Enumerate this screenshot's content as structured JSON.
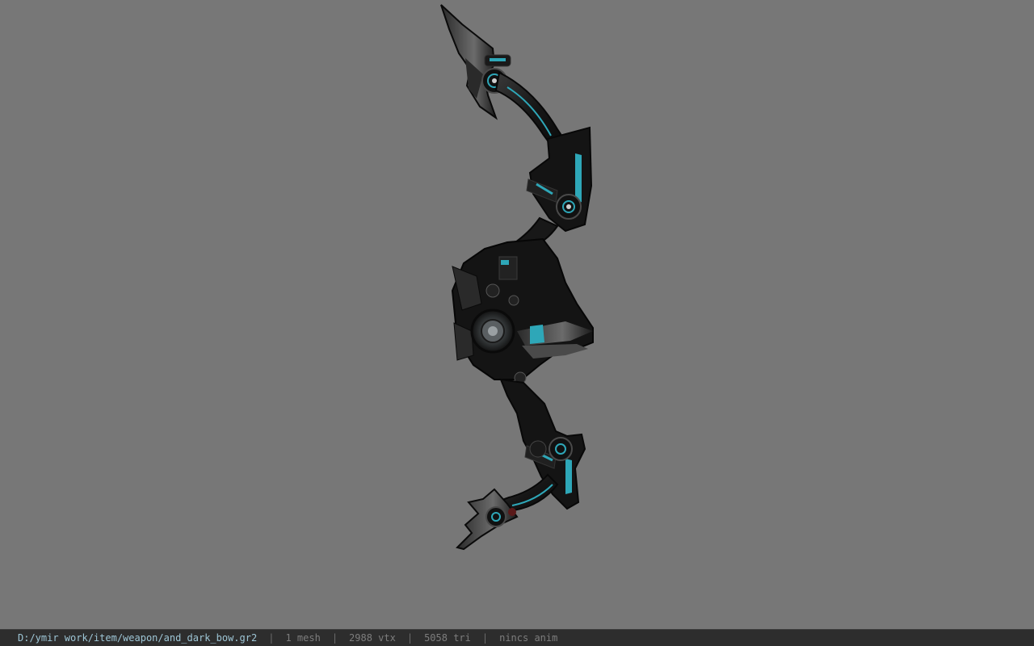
{
  "viewport": {
    "background_color": "#777777",
    "model_name": "and_dark_bow",
    "model_colors": {
      "body": "#151515",
      "armor": "#262626",
      "highlight": "#6a6a6a",
      "glow": "#2ea7b8"
    }
  },
  "status_bar": {
    "file_path": "D:/ymir work/item/weapon/and_dark_bow.gr2",
    "separator": "|",
    "mesh_count": "1 mesh",
    "vertex_count": "2988 vtx",
    "triangle_count": "5058 tri",
    "animation": "nincs anim",
    "background_color": "#2d2d2d",
    "path_color": "#9ec6d6"
  }
}
